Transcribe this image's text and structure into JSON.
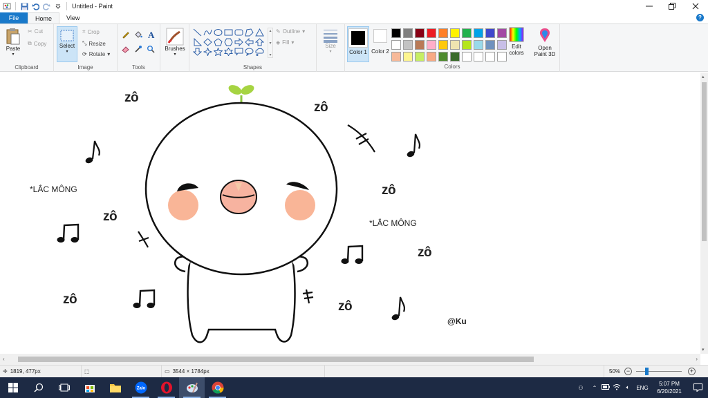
{
  "window": {
    "title": "Untitled - Paint"
  },
  "tabs": [
    {
      "label": "File"
    },
    {
      "label": "Home"
    },
    {
      "label": "View"
    }
  ],
  "ribbon": {
    "clipboard": {
      "paste": "Paste",
      "cut": "Cut",
      "copy": "Copy",
      "group": "Clipboard"
    },
    "image": {
      "select": "Select",
      "crop": "Crop",
      "resize": "Resize",
      "rotate": "Rotate",
      "group": "Image"
    },
    "tools": {
      "group": "Tools"
    },
    "brushes": {
      "label": "Brushes"
    },
    "shapes": {
      "outline": "Outline",
      "fill": "Fill",
      "group": "Shapes"
    },
    "size": {
      "label": "Size"
    },
    "colors": {
      "color1": "Color 1",
      "color2": "Color 2",
      "edit": "Edit colors",
      "paint3d": "Open Paint 3D",
      "group": "Colors",
      "color1_value": "#000000",
      "color2_value": "#ffffff",
      "palette": [
        "#000000",
        "#7f7f7f",
        "#880015",
        "#ed1c24",
        "#ff7f27",
        "#fff200",
        "#22b14c",
        "#00a2e8",
        "#3f48cc",
        "#a349a4",
        "#ffffff",
        "#c3c3c3",
        "#b97a57",
        "#ffaec9",
        "#ffc90e",
        "#efe4b0",
        "#b5e61d",
        "#99d9ea",
        "#7092be",
        "#c8bfe7",
        "#f7b999",
        "#fdf590",
        "#c6ee64",
        "#f7a983",
        "#4e8a2e",
        "#3a6b2a",
        "#ffffff",
        "#ffffff",
        "#ffffff",
        "#ffffff"
      ]
    }
  },
  "canvas": {
    "zo": "zô",
    "lac_mong": "*LẮC MÔNG",
    "signature": "@Ku"
  },
  "status": {
    "cursor_pos": "1819, 477px",
    "image_size": "3544 × 1784px",
    "zoom": "50%",
    "zoom_level": 0.5
  },
  "taskbar": {
    "lang": "ENG",
    "time": "5:07 PM",
    "date": "6/20/2021"
  }
}
